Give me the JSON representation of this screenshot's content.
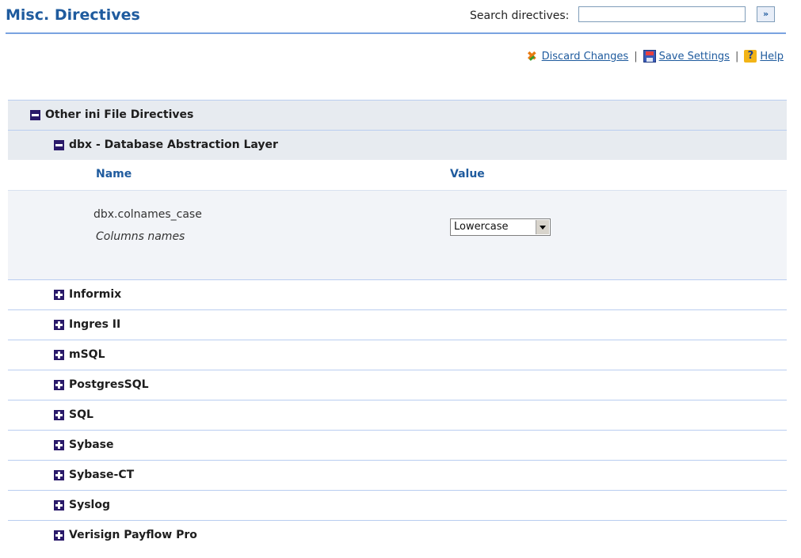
{
  "header": {
    "title": "Misc. Directives",
    "search_label": "Search directives:",
    "search_value": "",
    "search_go_label": "»"
  },
  "actions": {
    "discard": "Discard Changes",
    "save": "Save Settings",
    "help": "Help",
    "separator": "|",
    "icons": [
      "discard-icon",
      "save-icon",
      "help-icon"
    ]
  },
  "tree": {
    "section": "Other ini File Directives",
    "subsection": "dbx - Database Abstraction Layer",
    "columns": {
      "name": "Name",
      "value": "Value"
    },
    "directive": {
      "name": "dbx.colnames_case",
      "description": "Columns names",
      "selected_value": "Lowercase"
    },
    "collapsed_groups": [
      "Informix",
      "Ingres II",
      "mSQL",
      "PostgresSQL",
      "SQL",
      "Sybase",
      "Sybase-CT",
      "Syslog",
      "Verisign Payflow Pro"
    ]
  },
  "colors": {
    "title": "#1f5b9e",
    "header_rule": "#7aa3e0",
    "section_bg": "#e7ebf0",
    "toggle": "#2a1a6a",
    "row_divider": "#b9cdf0"
  }
}
